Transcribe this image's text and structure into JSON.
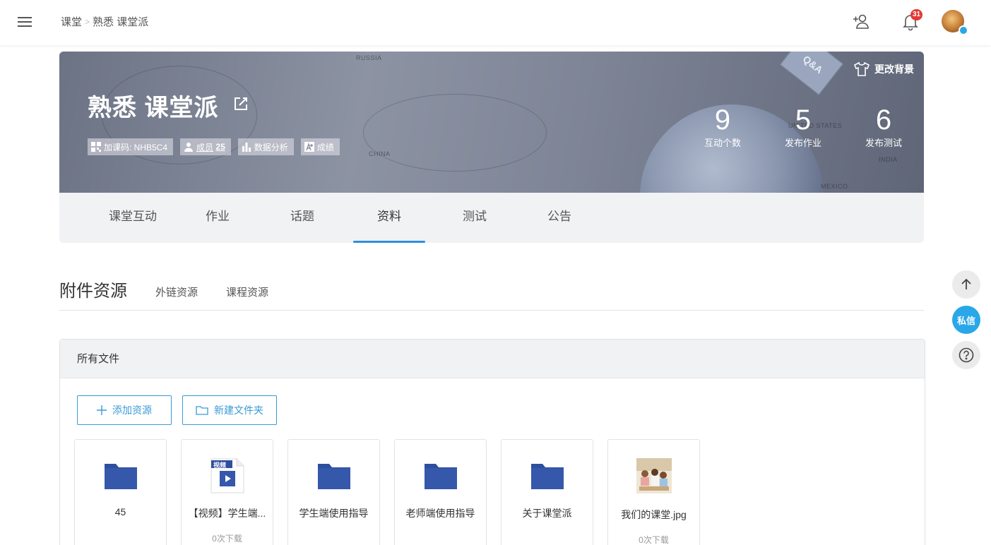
{
  "header": {
    "breadcrumb": [
      "课堂",
      "熟悉 课堂派"
    ],
    "breadcrumb_sep": ">",
    "notification_count": "31",
    "icons": [
      "menu-icon",
      "add-user-icon",
      "bell-icon",
      "avatar"
    ]
  },
  "banner": {
    "course_title": "熟悉 课堂派",
    "change_background_label": "更改背景",
    "chips": {
      "join_code": "加课码: NHB5C4",
      "members_label": "成员",
      "members_count": "25",
      "analytics": "数据分析",
      "grades": "成绩"
    },
    "stats": [
      {
        "value": "9",
        "label": "互动个数"
      },
      {
        "value": "5",
        "label": "发布作业"
      },
      {
        "value": "6",
        "label": "发布测试"
      }
    ],
    "map_labels": [
      "RUSSIA",
      "CHINA",
      "UNITED STATES",
      "MEXICO",
      "INDIA"
    ],
    "qa_card_text": "Q&A"
  },
  "tabs": [
    {
      "label": "课堂互动"
    },
    {
      "label": "作业"
    },
    {
      "label": "话题"
    },
    {
      "label": "资料",
      "active": true
    },
    {
      "label": "测试"
    },
    {
      "label": "公告"
    }
  ],
  "resources": {
    "title": "附件资源",
    "sub_tabs": [
      "外链资源",
      "课程资源"
    ],
    "panel_title": "所有文件",
    "add_resource_label": "添加资源",
    "new_folder_label": "新建文件夹",
    "files": [
      {
        "name": "45",
        "type": "folder",
        "downloads": ""
      },
      {
        "name": "【视频】学生端...",
        "type": "video",
        "downloads": "0次下载",
        "video_tag": "视频"
      },
      {
        "name": "学生端使用指导",
        "type": "folder",
        "downloads": ""
      },
      {
        "name": "老师端使用指导",
        "type": "folder",
        "downloads": ""
      },
      {
        "name": "关于课堂派",
        "type": "folder",
        "downloads": ""
      },
      {
        "name": "我们的课堂.jpg",
        "type": "image",
        "downloads": "0次下载"
      }
    ]
  },
  "floating": {
    "message_label": "私信"
  },
  "colors": {
    "accent": "#2f8fe0",
    "button_border": "#3a9bd5",
    "folder": "#2e4f9e",
    "badge": "#e53935",
    "message_button": "#29a7e8"
  }
}
